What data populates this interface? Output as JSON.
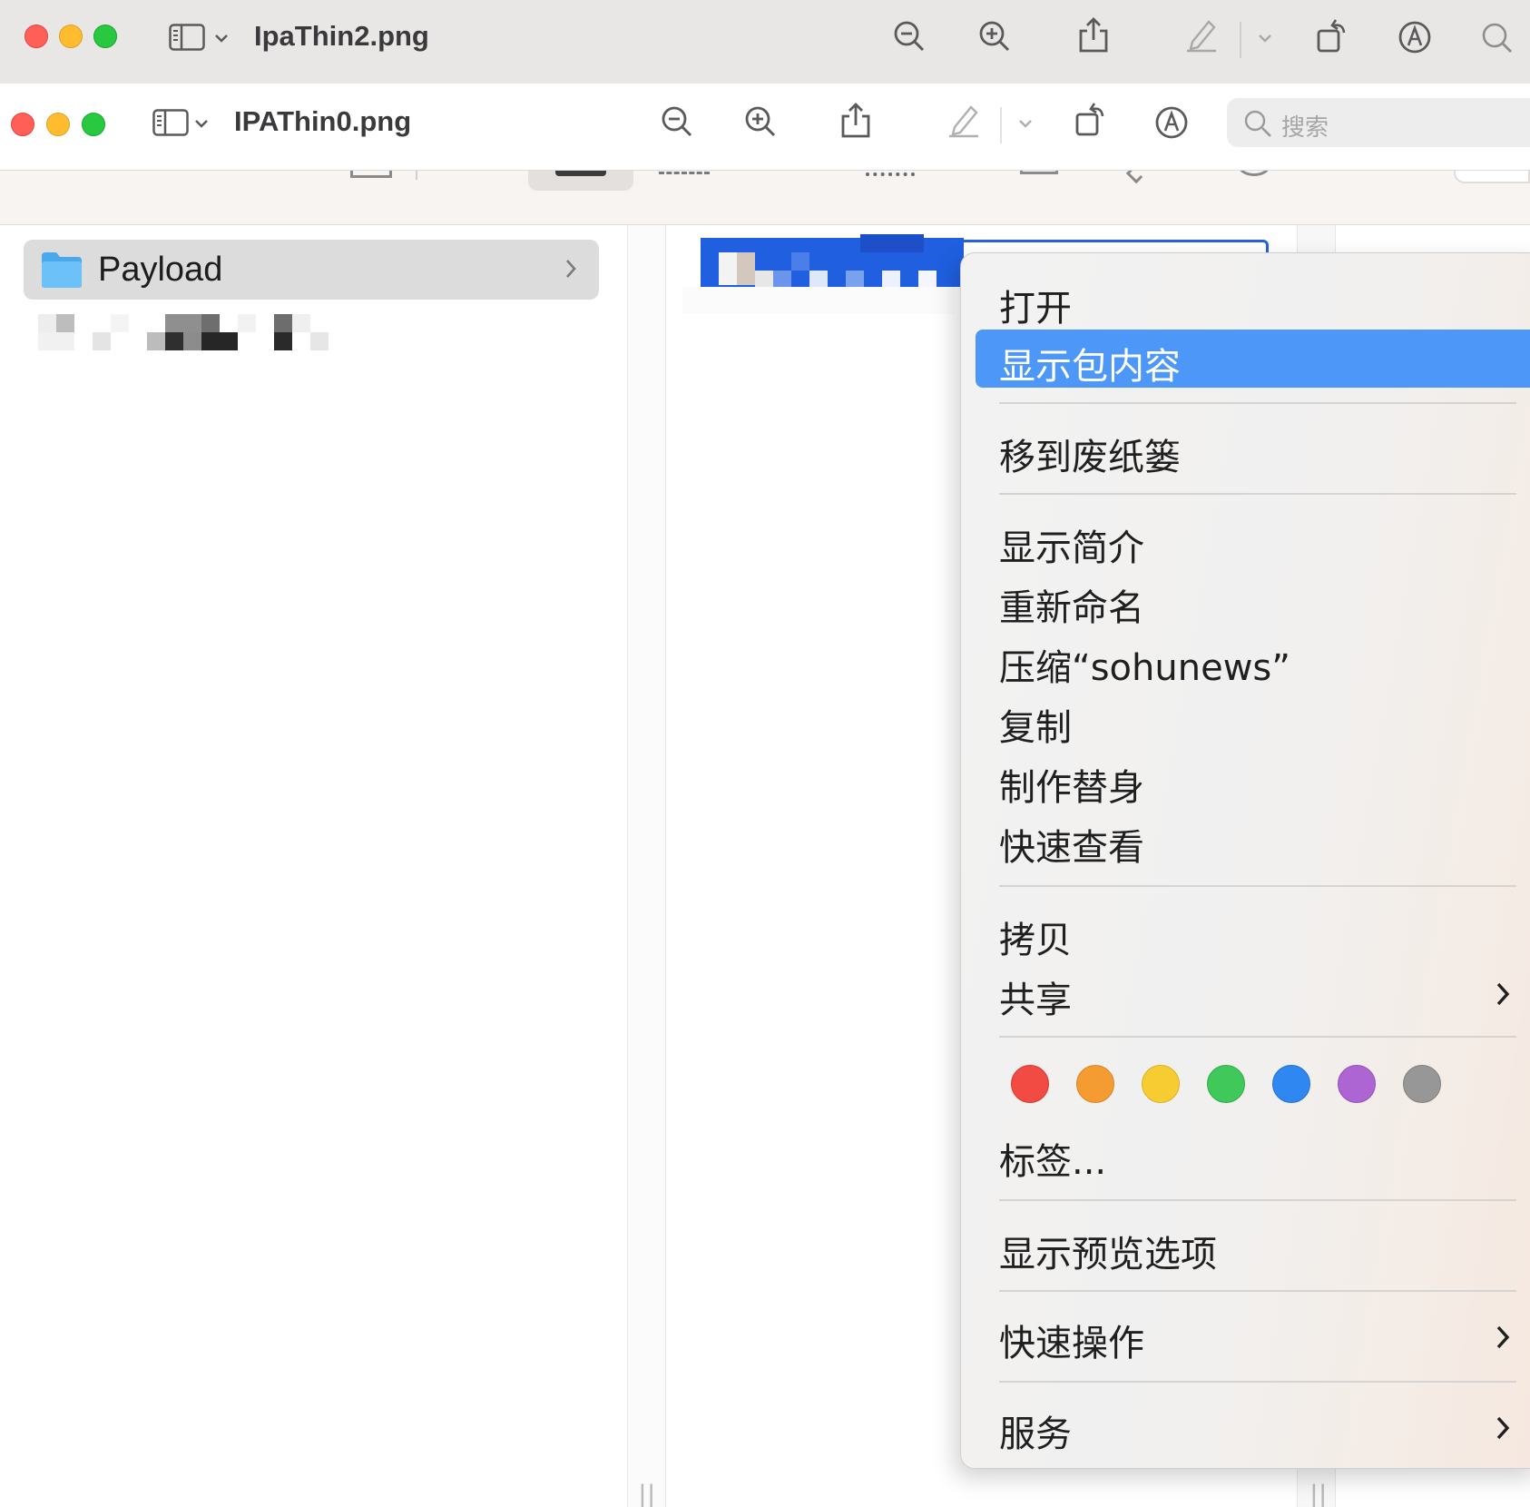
{
  "back_window": {
    "title": "IpaThin2.png"
  },
  "front_window": {
    "title": "IPAThin0.png",
    "search_placeholder": "搜索"
  },
  "toolbar_icons": [
    "sidebar-toggle-icon",
    "chevron-down-icon",
    "zoom-out-icon",
    "zoom-in-icon",
    "share-icon",
    "markup-pencil-icon",
    "rotate-icon",
    "annotate-icon",
    "search-icon"
  ],
  "finder": {
    "folder_name": "Payload",
    "grip": "||"
  },
  "context_menu": {
    "items": {
      "open": "打开",
      "show_package_contents": "显示包内容",
      "move_to_trash": "移到废纸篓",
      "get_info": "显示简介",
      "rename": "重新命名",
      "compress": "压缩“sohunews”",
      "duplicate": "复制",
      "make_alias": "制作替身",
      "quick_look": "快速查看",
      "copy": "拷贝",
      "share": "共享",
      "tags": "标签...",
      "show_view_options": "显示预览选项",
      "quick_actions": "快速操作",
      "services": "服务"
    },
    "tag_colors": [
      "#f24b43",
      "#f49c32",
      "#f7cb32",
      "#40c85a",
      "#2f88f2",
      "#ad65d4",
      "#979797"
    ]
  },
  "colors": {
    "highlight": "#4c97f7",
    "selection": "#1f5fe0"
  }
}
